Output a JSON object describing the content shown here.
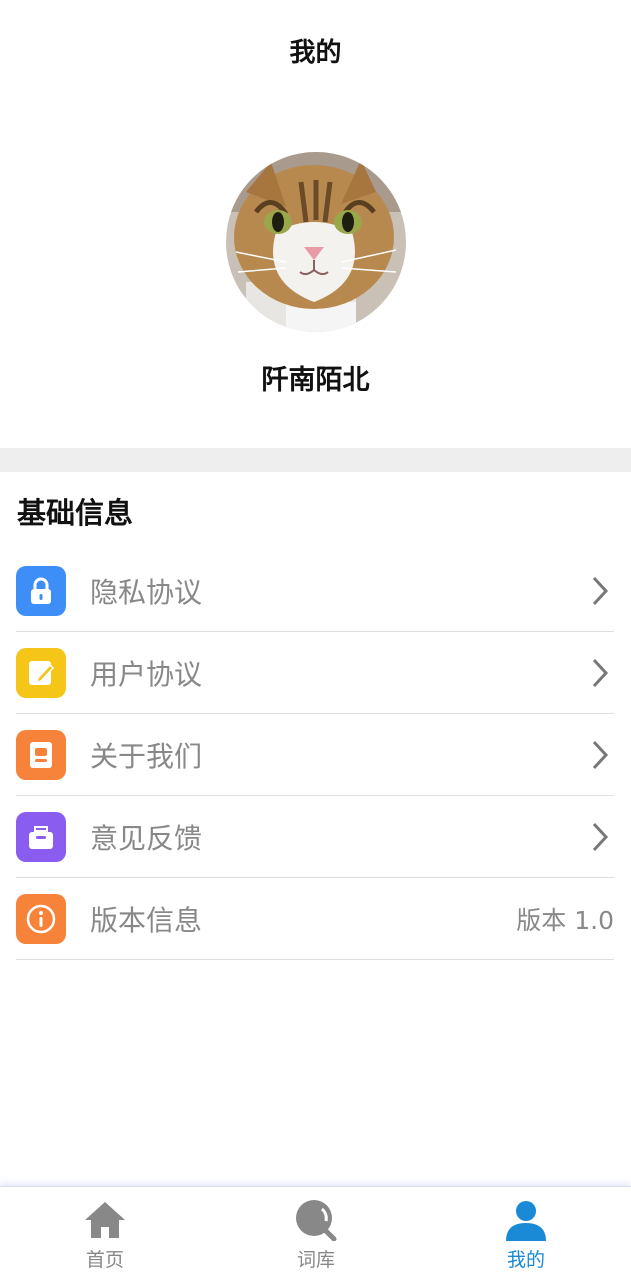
{
  "header": {
    "title": "我的"
  },
  "profile": {
    "username": "阡南陌北"
  },
  "section": {
    "title": "基础信息"
  },
  "menu": [
    {
      "label": "隐私协议",
      "icon": "lock-icon",
      "color": "#3d8ff7"
    },
    {
      "label": "用户协议",
      "icon": "edit-icon",
      "color": "#f5c518"
    },
    {
      "label": "关于我们",
      "icon": "contact-card-icon",
      "color": "#f7823a"
    },
    {
      "label": "意见反馈",
      "icon": "feedback-icon",
      "color": "#8a5cf0"
    },
    {
      "label": "版本信息",
      "icon": "info-icon",
      "color": "#f7823a",
      "value": "版本 1.0"
    }
  ],
  "tabbar": [
    {
      "label": "首页",
      "icon": "home-icon",
      "active": false
    },
    {
      "label": "词库",
      "icon": "search-icon",
      "active": false
    },
    {
      "label": "我的",
      "icon": "user-icon",
      "active": true
    }
  ],
  "colors": {
    "accent": "#1a8ad6",
    "inactive": "#888888"
  }
}
